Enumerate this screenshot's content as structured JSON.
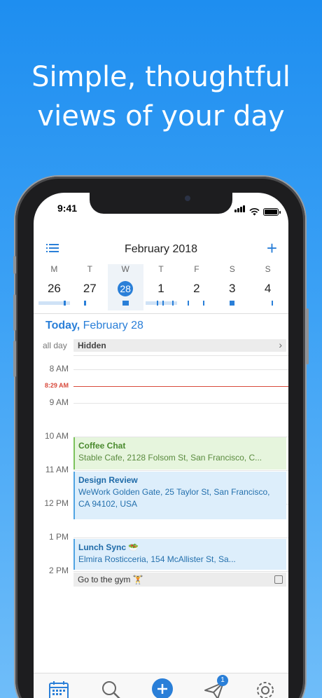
{
  "promo": {
    "line1": "Simple, thoughtful",
    "line2": "views of your day"
  },
  "status_bar": {
    "time": "9:41"
  },
  "header": {
    "month_title": "February 2018",
    "add_icon": "plus-icon",
    "menu_icon": "list-icon"
  },
  "week": {
    "days": [
      {
        "dow": "M",
        "num": "26"
      },
      {
        "dow": "T",
        "num": "27"
      },
      {
        "dow": "W",
        "num": "28"
      },
      {
        "dow": "T",
        "num": "1"
      },
      {
        "dow": "F",
        "num": "2"
      },
      {
        "dow": "S",
        "num": "3"
      },
      {
        "dow": "S",
        "num": "4"
      }
    ],
    "selected_index": 2
  },
  "agenda": {
    "today_prefix": "Today,",
    "today_date": "February 28",
    "allday_label": "all day",
    "allday_value": "Hidden",
    "hours": [
      "8 AM",
      "9 AM",
      "10 AM",
      "11 AM",
      "12 PM",
      "1 PM",
      "2 PM"
    ],
    "now_label": "8:29 AM",
    "events": [
      {
        "title": "Coffee Chat",
        "location": "Stable Cafe, 2128 Folsom St, San Francisco, C..."
      },
      {
        "title": "Design Review",
        "location": "WeWork Golden Gate, 25 Taylor St, San Francisco, CA 94102, USA"
      },
      {
        "title": "Lunch Sync 🥗",
        "location": "Elmira Rosticceria, 154 McAllister St, Sa..."
      }
    ],
    "task": {
      "title": "Go to the gym 🏋"
    }
  },
  "tabbar": {
    "items": [
      "calendar-icon",
      "search-icon",
      "add-circle-icon",
      "send-icon",
      "gear-icon"
    ],
    "badge_count": "1"
  },
  "colors": {
    "accent": "#2a7fd8",
    "now_line": "#d84a3c",
    "event_green": "#e6f5dd",
    "event_blue": "#ddeefb"
  }
}
